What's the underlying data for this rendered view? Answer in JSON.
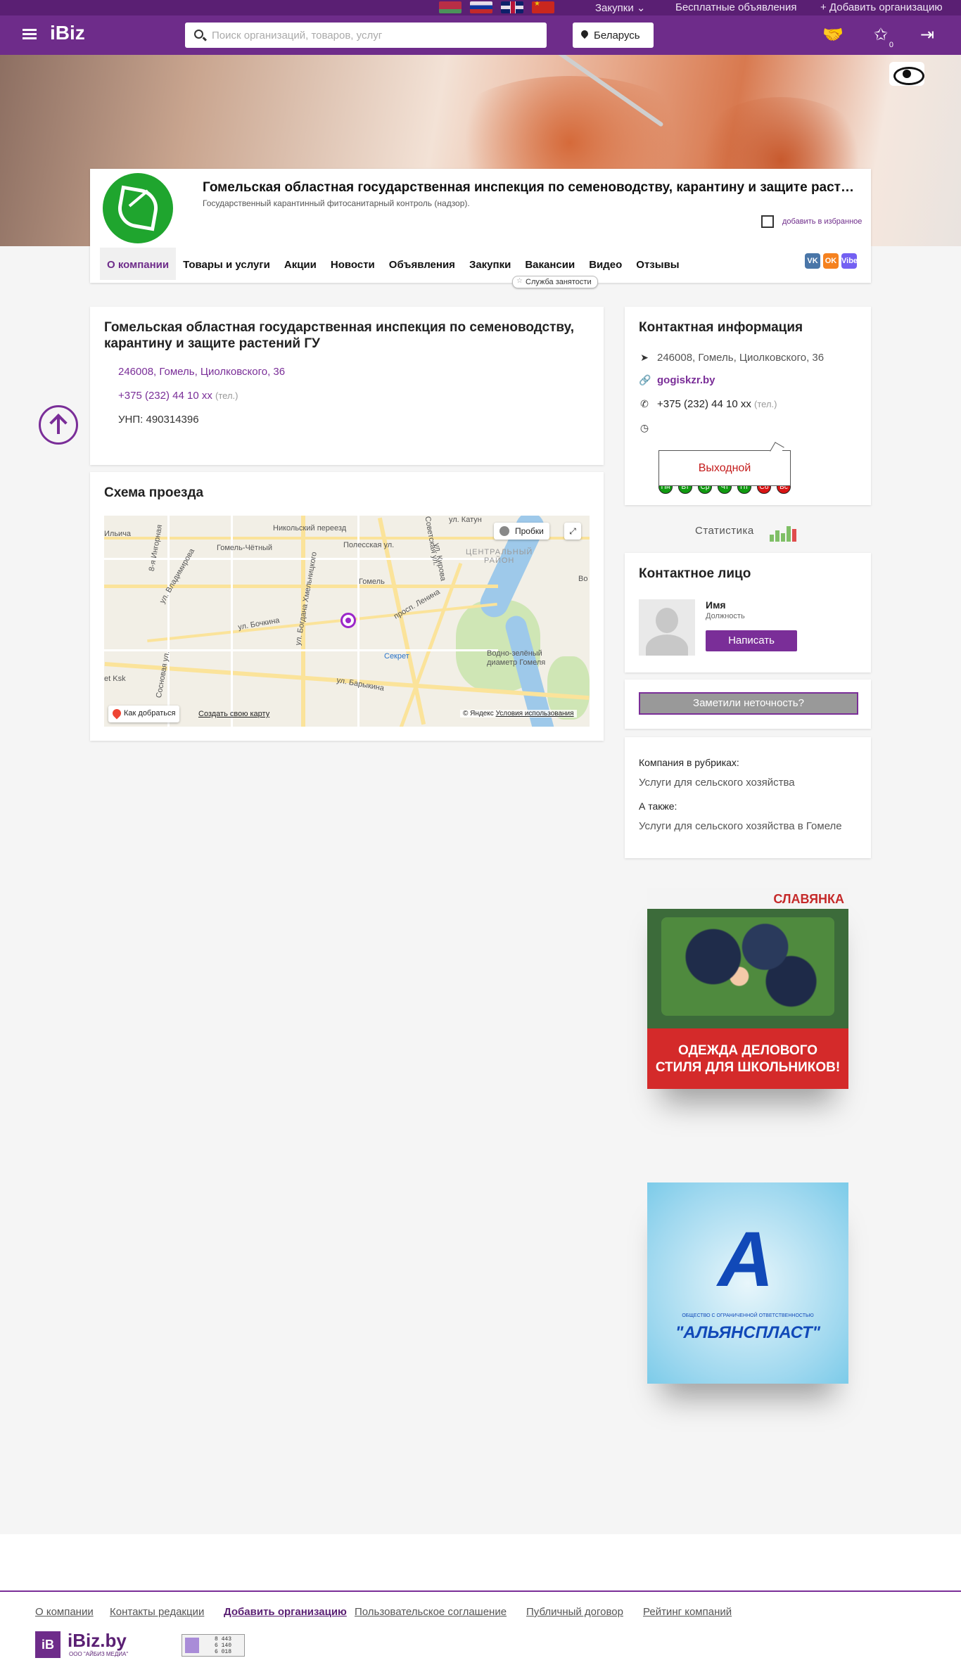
{
  "topbar": {
    "flags": [
      "by",
      "ru",
      "gb",
      "cn"
    ],
    "purchases": "Закупки",
    "free_ads": "Бесплатные объявления",
    "add_org": "+ Добавить организацию"
  },
  "header": {
    "logo": "iBiz",
    "search_placeholder": "Поиск организаций, товаров, услуг",
    "region": "Беларусь",
    "favorites_count": "0"
  },
  "company": {
    "name": "Гомельская областная государственная инспекция по семеноводству, карантину и защите растений ГУ",
    "subtitle": "Государственный карантинный фитосанитарный контроль (надзор).",
    "add_favorite": "добавить в избранное",
    "tabs": [
      "О компании",
      "Товары и услуги",
      "Акции",
      "Новости",
      "Объявления",
      "Закупки",
      "Вакансии",
      "Видео",
      "Отзывы"
    ],
    "tooltip": "Служба занятости",
    "social": [
      "VK",
      "OK",
      "Viber"
    ]
  },
  "about": {
    "title": "Гомельская областная государственная инспекция по семеноводству, карантину и защите растений ГУ",
    "address": "246008, Гомель, Циолковского, 36",
    "phone": "+375 (232) 44 10 xx",
    "phone_note": "(тел.)",
    "unp": "УНП: 490314396"
  },
  "map": {
    "title": "Схема проезда",
    "traffic": "Пробки",
    "route": "Как добраться",
    "create": "Создать свою карту",
    "copyright": "© Яндекс",
    "terms": "Условия использования",
    "labels": {
      "nikolsky": "Никольский переезд",
      "gomel_chetny": "Гомель-Чётный",
      "ilicha": "Ильича",
      "polesskaya": "Полесская ул.",
      "central": "ЦЕНТРАЛЬНЫЙ",
      "district": "РАЙОН",
      "gomel": "Гомель",
      "lenina": "просп. Ленина",
      "bochkina": "ул. Бочкина",
      "khmelnitsky": "ул. Богдана Хмельницкого",
      "sekret": "Секрет",
      "vodno1": "Водно-зелёный",
      "vodno2": "диаметр Гомеля",
      "barykina": "ул. Барыкина",
      "ksk": "et Ksk",
      "sovetskaya": "Советская ул.",
      "kirova": "ул. Кирова",
      "katuna": "ул. Катун",
      "vladimirova": "ул. Владимирова",
      "sosnovaya": "Сосновая ул.",
      "ingornaya": "8-я Ингорная",
      "vo": "Во"
    }
  },
  "contact_info": {
    "title": "Контактная информация",
    "address": "246008, Гомель, Циолковского, 36",
    "site": "gogiskzr.by",
    "phone": "+375 (232) 44 10 xx",
    "phone_note": "(тел.)",
    "days": [
      "Пн",
      "Вт",
      "Ср",
      "Чт",
      "Пт",
      "Сб",
      "Вс"
    ],
    "day_status": [
      "open",
      "open",
      "open",
      "open",
      "open",
      "closed",
      "closed"
    ],
    "closed_label": "Выходной"
  },
  "statistics": "Статистика",
  "contact_person": {
    "title": "Контактное лицо",
    "name": "Имя",
    "position": "Должность",
    "write": "Написать"
  },
  "report": "Заметили неточность?",
  "rubrics": {
    "label": "Компания в рубриках:",
    "rubric": "Услуги для сельского хозяйства",
    "also_label": "А также:",
    "also": "Услуги для сельского хозяйства в Гомеле"
  },
  "ads": {
    "ad1_brand": "СЛАВЯНКА",
    "ad1_line1": "ОДЕЖДА ДЕЛОВОГО",
    "ad1_line2": "СТИЛЯ ДЛЯ ШКОЛЬНИКОВ!",
    "ad2_tag": "ОБЩЕСТВО С ОГРАНИЧЕННОЙ ОТВЕТСТВЕННОСТЬЮ",
    "ad2_name": "\"АЛЬЯНСПЛАСТ\""
  },
  "footer": {
    "links": [
      "О компании",
      "Контакты редакции",
      "Добавить организацию",
      "Пользовательское соглашение",
      "Публичный договор",
      "Рейтинг компаний"
    ],
    "logo_mark": "iB",
    "logo_text": "iBiz.by",
    "logo_sub": "ООО \"АЙБИЗ МЕДИА\"",
    "counter": [
      "8 443",
      "6 140",
      "6 018"
    ]
  }
}
